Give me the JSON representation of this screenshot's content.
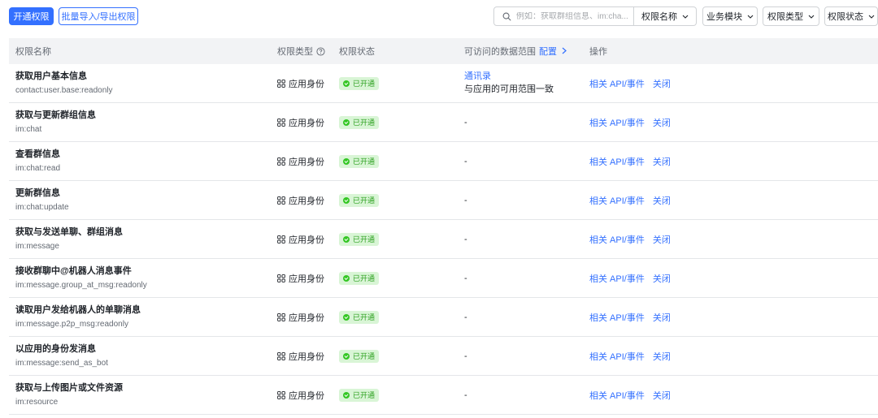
{
  "toolbar": {
    "open_permission_label": "开通权限",
    "batch_label": "批量导入/导出权限",
    "search_placeholder": "例如：获取群组信息、im:cha...",
    "search_scope": "权限名称",
    "filters": [
      "业务模块",
      "权限类型",
      "权限状态"
    ]
  },
  "table": {
    "columns": {
      "name": "权限名称",
      "type": "权限类型",
      "status": "权限状态",
      "range": "可访问的数据范围",
      "range_config": "配置",
      "ops": "操作"
    },
    "rows": [
      {
        "name": "获取用户基本信息",
        "scope": "contact:user.base:readonly",
        "type": "应用身份",
        "status": "已开通",
        "range_link": "通讯录",
        "range_desc": "与应用的可用范围一致",
        "op_api": "相关 API/事件",
        "op_close": "关闭"
      },
      {
        "name": "获取与更新群组信息",
        "scope": "im:chat",
        "type": "应用身份",
        "status": "已开通",
        "range": "-",
        "op_api": "相关 API/事件",
        "op_close": "关闭"
      },
      {
        "name": "查看群信息",
        "scope": "im:chat:read",
        "type": "应用身份",
        "status": "已开通",
        "range": "-",
        "op_api": "相关 API/事件",
        "op_close": "关闭"
      },
      {
        "name": "更新群信息",
        "scope": "im:chat:update",
        "type": "应用身份",
        "status": "已开通",
        "range": "-",
        "op_api": "相关 API/事件",
        "op_close": "关闭"
      },
      {
        "name": "获取与发送单聊、群组消息",
        "scope": "im:message",
        "type": "应用身份",
        "status": "已开通",
        "range": "-",
        "op_api": "相关 API/事件",
        "op_close": "关闭"
      },
      {
        "name": "接收群聊中@机器人消息事件",
        "scope": "im:message.group_at_msg:readonly",
        "type": "应用身份",
        "status": "已开通",
        "range": "-",
        "op_api": "相关 API/事件",
        "op_close": "关闭"
      },
      {
        "name": "读取用户发给机器人的单聊消息",
        "scope": "im:message.p2p_msg:readonly",
        "type": "应用身份",
        "status": "已开通",
        "range": "-",
        "op_api": "相关 API/事件",
        "op_close": "关闭"
      },
      {
        "name": "以应用的身份发消息",
        "scope": "im:message:send_as_bot",
        "type": "应用身份",
        "status": "已开通",
        "range": "-",
        "op_api": "相关 API/事件",
        "op_close": "关闭"
      },
      {
        "name": "获取与上传图片或文件资源",
        "scope": "im:resource",
        "type": "应用身份",
        "status": "已开通",
        "range": "-",
        "op_api": "相关 API/事件",
        "op_close": "关闭"
      }
    ]
  },
  "colors": {
    "accent": "#3370ff",
    "success": "#2ea121",
    "success_bg": "#d9f5d6",
    "header_bg": "#f2f3f5"
  }
}
